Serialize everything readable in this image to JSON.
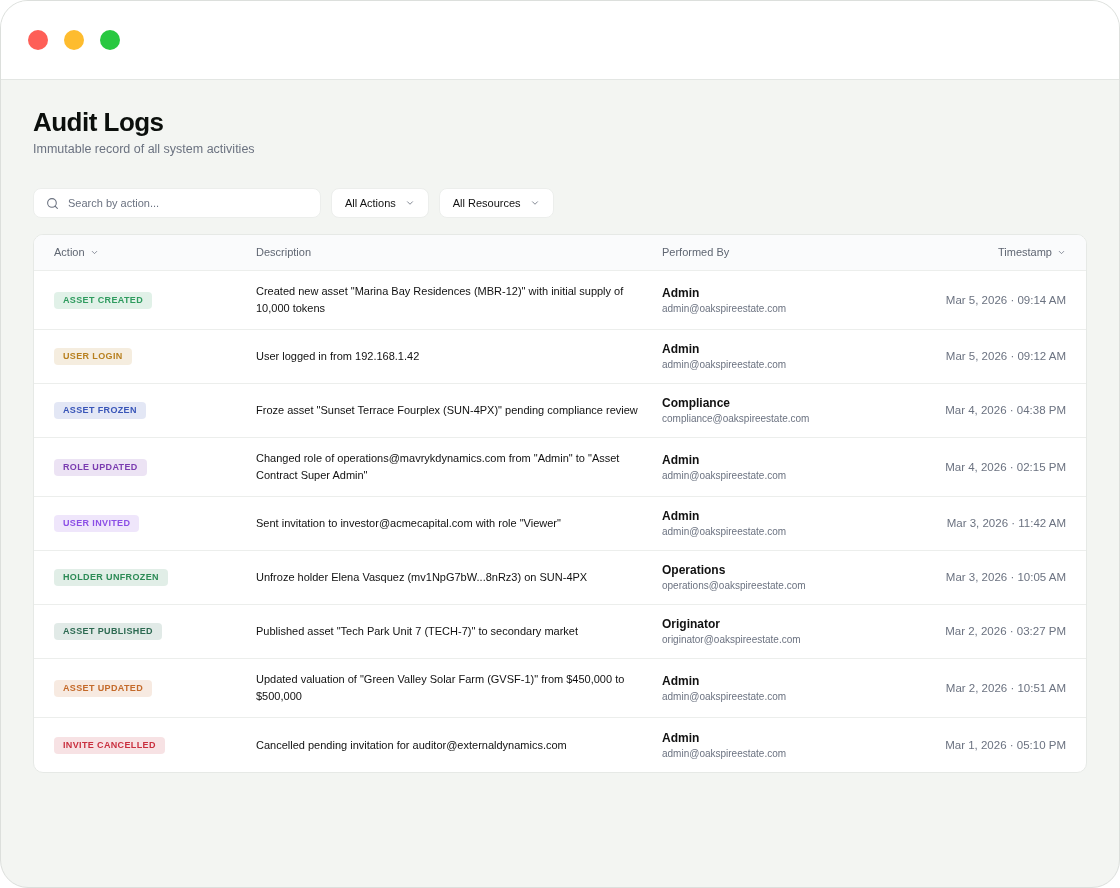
{
  "window": {
    "traffic_lights": [
      {
        "color": "#fe5f57"
      },
      {
        "color": "#febc2e"
      },
      {
        "color": "#28c840"
      }
    ]
  },
  "header": {
    "title": "Audit Logs",
    "subtitle": "Immutable record of all system activities"
  },
  "filters": {
    "search": {
      "placeholder": "Search by action..."
    },
    "dropdowns": [
      {
        "label": "All Actions"
      },
      {
        "label": "All Resources"
      }
    ]
  },
  "table": {
    "columns": [
      {
        "label": "Action",
        "sortable": true
      },
      {
        "label": "Description",
        "sortable": false
      },
      {
        "label": "Performed By",
        "sortable": false
      },
      {
        "label": "Timestamp",
        "sortable": true
      }
    ],
    "rows": [
      {
        "action": "ASSET CREATED",
        "color": "#2e9b5e",
        "description": "Created new asset \"Marina Bay Residences (MBR-12)\" with initial supply of 10,000 tokens",
        "user": {
          "name": "Admin",
          "email": "admin@oakspireestate.com"
        },
        "timestamp": "Mar 5, 2026 · 09:14 AM"
      },
      {
        "action": "USER LOGIN",
        "color": "#b8801f",
        "description": "User logged in from 192.168.1.42",
        "user": {
          "name": "Admin",
          "email": "admin@oakspireestate.com"
        },
        "timestamp": "Mar 5, 2026 · 09:12 AM"
      },
      {
        "action": "ASSET FROZEN",
        "color": "#3855b8",
        "description": "Froze asset \"Sunset Terrace Fourplex (SUN-4PX)\" pending compliance review",
        "user": {
          "name": "Compliance",
          "email": "compliance@oakspireestate.com"
        },
        "timestamp": "Mar 4, 2026 · 04:38 PM"
      },
      {
        "action": "ROLE UPDATED",
        "color": "#7a3cb0",
        "description": "Changed role of operations@mavrykdynamics.com from \"Admin\" to \"Asset Contract Super Admin\"",
        "user": {
          "name": "Admin",
          "email": "admin@oakspireestate.com"
        },
        "timestamp": "Mar 4, 2026 · 02:15 PM"
      },
      {
        "action": "USER INVITED",
        "color": "#8c4fe6",
        "description": "Sent invitation to investor@acmecapital.com with role \"Viewer\"",
        "user": {
          "name": "Admin",
          "email": "admin@oakspireestate.com"
        },
        "timestamp": "Mar 3, 2026 · 11:42 AM"
      },
      {
        "action": "HOLDER UNFROZEN",
        "color": "#2b8a55",
        "description": "Unfroze holder Elena Vasquez (mv1NpG7bW...8nRz3) on SUN-4PX",
        "user": {
          "name": "Operations",
          "email": "operations@oakspireestate.com"
        },
        "timestamp": "Mar 3, 2026 · 10:05 AM"
      },
      {
        "action": "ASSET PUBLISHED",
        "color": "#2d6a52",
        "description": "Published asset \"Tech Park Unit 7 (TECH-7)\" to secondary market",
        "user": {
          "name": "Originator",
          "email": "originator@oakspireestate.com"
        },
        "timestamp": "Mar 2, 2026 · 03:27 PM"
      },
      {
        "action": "ASSET UPDATED",
        "color": "#c46a2a",
        "description": "Updated valuation of \"Green Valley Solar Farm (GVSF-1)\" from $450,000 to $500,000",
        "user": {
          "name": "Admin",
          "email": "admin@oakspireestate.com"
        },
        "timestamp": "Mar 2, 2026 · 10:51 AM"
      },
      {
        "action": "INVITE CANCELLED",
        "color": "#c9303f",
        "description": "Cancelled pending invitation for auditor@externaldynamics.com",
        "user": {
          "name": "Admin",
          "email": "admin@oakspireestate.com"
        },
        "timestamp": "Mar 1, 2026 · 05:10 PM"
      }
    ]
  }
}
